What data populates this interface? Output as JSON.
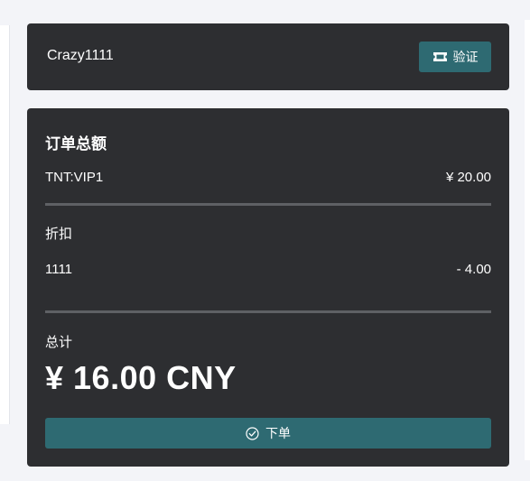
{
  "coupon": {
    "code": "Crazy1111",
    "verify_label": "验证",
    "verify_icon": "ticket-icon"
  },
  "summary": {
    "title": "订单总额",
    "item": {
      "name": "TNT:VIP1",
      "price": "¥ 20.00"
    },
    "discount_label": "折扣",
    "discount": {
      "code": "1111",
      "amount": "- 4.00"
    },
    "total_label": "总计",
    "total_amount": "¥ 16.00 CNY",
    "order_label": "下单",
    "order_icon": "check-circle-icon"
  },
  "colors": {
    "background": "#f3f4f8",
    "card": "#2d2e31",
    "accent_button": "#2e6a72",
    "divider": "#5e6064"
  }
}
